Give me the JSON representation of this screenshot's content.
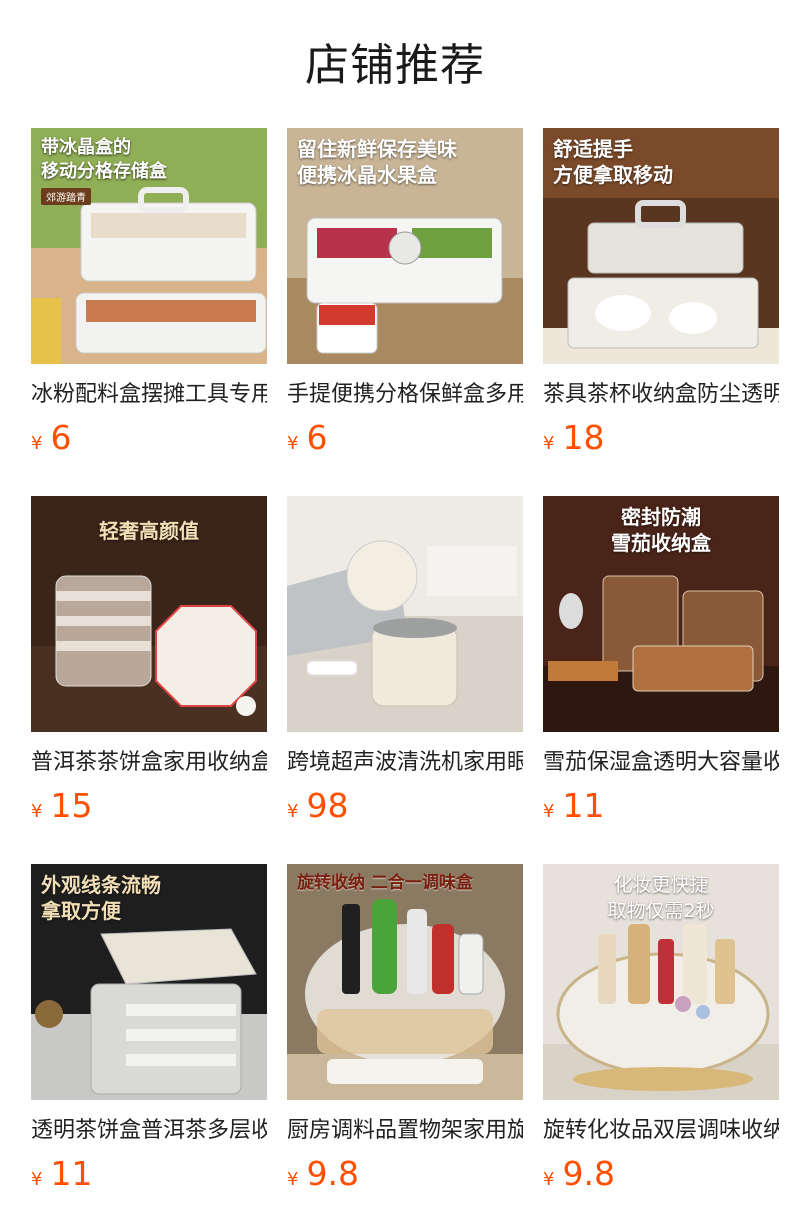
{
  "page_title": "店铺推荐",
  "colors": {
    "price": "#ff5000",
    "title": "#1a1a1a"
  },
  "products": [
    {
      "name": "冰粉配料盒摆摊工具专用",
      "currency": "¥",
      "price": "6",
      "overlay": "带冰晶盒的\n移动分格存储盒",
      "badge": "郊游踏青"
    },
    {
      "name": "手提便携分格保鲜盒多用",
      "currency": "¥",
      "price": "6",
      "overlay": "留住新鲜保存美味\n便携冰晶水果盒"
    },
    {
      "name": "茶具茶杯收纳盒防尘透明",
      "currency": "¥",
      "price": "18",
      "overlay": "舒适提手\n方便拿取移动"
    },
    {
      "name": "普洱茶茶饼盒家用收纳盒",
      "currency": "¥",
      "price": "15",
      "overlay": "轻奢高颜值"
    },
    {
      "name": "跨境超声波清洗机家用眼镜",
      "currency": "¥",
      "price": "98",
      "overlay": ""
    },
    {
      "name": "雪茄保湿盒透明大容量收纳",
      "currency": "¥",
      "price": "11",
      "overlay": "密封防潮\n雪茄收纳盒"
    },
    {
      "name": "透明茶饼盒普洱茶多层收纳",
      "currency": "¥",
      "price": "11",
      "overlay": "外观线条流畅\n拿取方便"
    },
    {
      "name": "厨房调料品置物架家用旋转",
      "currency": "¥",
      "price": "9.8",
      "overlay": "旋转收纳 二合一调味盒"
    },
    {
      "name": "旋转化妆品双层调味收纳盒",
      "currency": "¥",
      "price": "9.8",
      "overlay": "化妆更快捷\n取物仅需2秒"
    }
  ]
}
